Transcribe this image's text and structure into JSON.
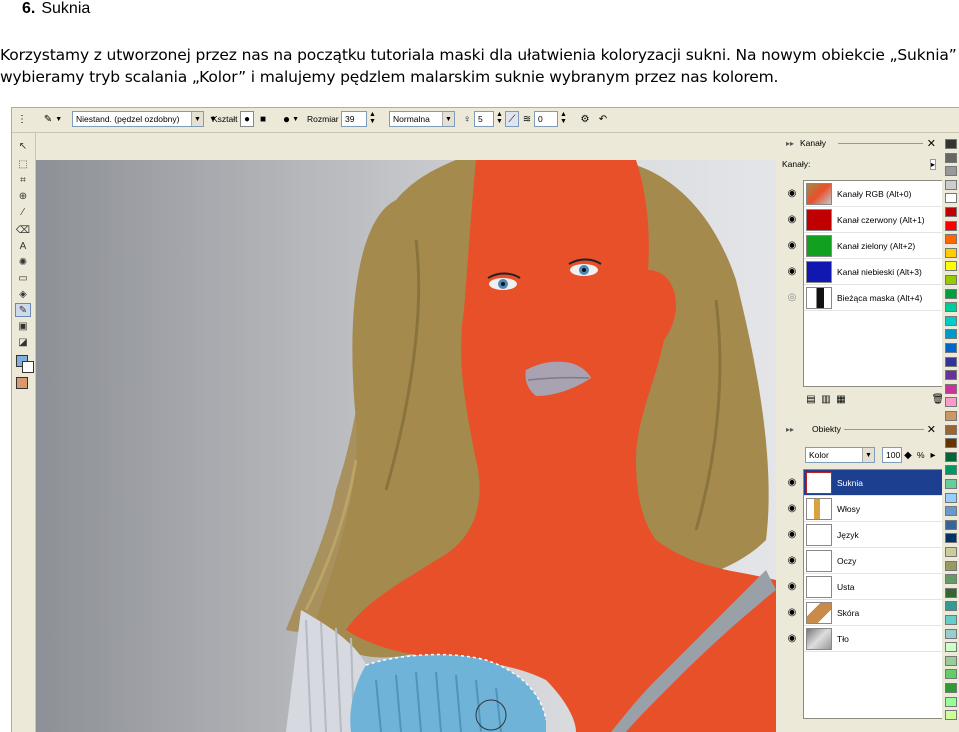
{
  "doc": {
    "heading_number": "6.",
    "heading_title": "Suknia",
    "paragraph_line1": "Korzystamy z utworzonej przez nas na początku tutoriala maski dla ułatwienia koloryzacji sukni. Na nowym obiekcie „Suknia”",
    "paragraph_line2": "wybieramy tryb scalania „Kolor” i malujemy pędzlem malarskim suknie wybranym przez nas kolorem."
  },
  "toolbar": {
    "brush_preset": "Niestand. (pędzel ozdobny)",
    "shape_label": "Kształt",
    "size_label": "Rozmiar",
    "size_value": "39",
    "blend_mode": "Normalna",
    "opacity_value": "5",
    "flow_value": "0"
  },
  "channels_panel": {
    "title": "Kanały",
    "section_label": "Kanały:",
    "rows": [
      {
        "label": "Kanały RGB (Alt+0)"
      },
      {
        "label": "Kanał czerwony (Alt+1)"
      },
      {
        "label": "Kanał zielony (Alt+2)"
      },
      {
        "label": "Kanał niebieski (Alt+3)"
      },
      {
        "label": "Bieżąca maska (Alt+4)"
      }
    ]
  },
  "objects_panel": {
    "title": "Obiekty",
    "mode": "Kolor",
    "opacity": "100",
    "opacity_unit": "%",
    "rows": [
      {
        "label": "Suknia"
      },
      {
        "label": "Włosy"
      },
      {
        "label": "Język"
      },
      {
        "label": "Oczy"
      },
      {
        "label": "Usta"
      },
      {
        "label": "Skóra"
      },
      {
        "label": "Tło"
      }
    ]
  },
  "colors": {
    "skin_overlay": "#e8502a",
    "hair": "#a48a4c",
    "dress_paint": "#6fb4d8",
    "selection": "#1d3f8f",
    "primary_color": "#7fb0dd",
    "secondary_color": "#d89a6a"
  },
  "palette": [
    "#333333",
    "#666666",
    "#999999",
    "#cccccc",
    "#ffffff",
    "#c00000",
    "#ff0000",
    "#ff6600",
    "#ffcc00",
    "#ffff00",
    "#99cc00",
    "#00a040",
    "#00cc99",
    "#00cccc",
    "#0099cc",
    "#0066cc",
    "#333399",
    "#663399",
    "#cc3399",
    "#ff99cc",
    "#cc9966",
    "#996633",
    "#663300",
    "#006633",
    "#009966",
    "#66cc99",
    "#99ccff",
    "#6699cc",
    "#336699",
    "#003366",
    "#cccc99",
    "#999966",
    "#669966",
    "#336633",
    "#339999",
    "#66cccc",
    "#99cccc",
    "#ccffcc",
    "#99cc99",
    "#66cc66",
    "#339933",
    "#99ff99",
    "#ccff99"
  ]
}
